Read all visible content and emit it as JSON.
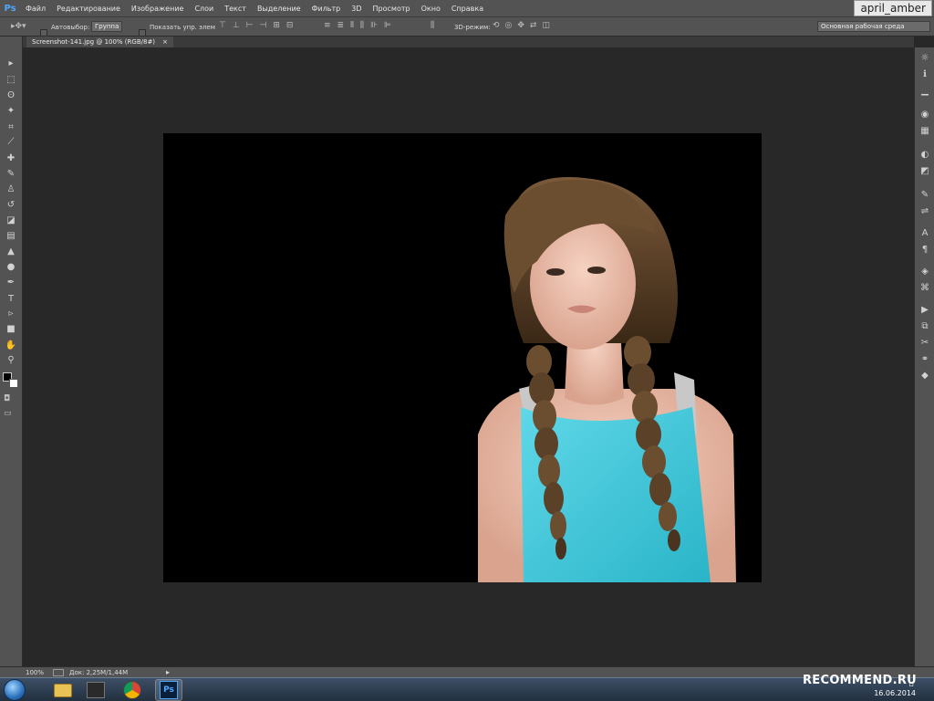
{
  "app": {
    "logo": "Ps"
  },
  "menu": [
    "Файл",
    "Редактирование",
    "Изображение",
    "Слои",
    "Текст",
    "Выделение",
    "Фильтр",
    "3D",
    "Просмотр",
    "Окно",
    "Справка"
  ],
  "watermark_user": "april_amber",
  "options": {
    "autoselect_label": "Автовыбор:",
    "autoselect_value": "Группа",
    "show_controls_label": "Показать упр. элем",
    "mode3d_label": "3D-режим:",
    "workspace": "Основная рабочая среда"
  },
  "document": {
    "tab_title": "Screenshot-141.jpg @ 100% (RGB/8#)",
    "close_glyph": "×"
  },
  "status": {
    "zoom": "100%",
    "doc_info": "Док: 2,25M/1,44M"
  },
  "taskbar": {
    "date": "16.06.2014",
    "watermark": "RECOMMEND.RU"
  },
  "tools": [
    {
      "name": "move-tool-icon",
      "glyph": "▸"
    },
    {
      "name": "marquee-tool-icon",
      "glyph": "⬚"
    },
    {
      "name": "lasso-tool-icon",
      "glyph": "ʘ"
    },
    {
      "name": "magic-wand-tool-icon",
      "glyph": "✦"
    },
    {
      "name": "crop-tool-icon",
      "glyph": "⌗"
    },
    {
      "name": "eyedropper-tool-icon",
      "glyph": "⟋"
    },
    {
      "name": "healing-brush-tool-icon",
      "glyph": "✚"
    },
    {
      "name": "brush-tool-icon",
      "glyph": "✎"
    },
    {
      "name": "clone-stamp-tool-icon",
      "glyph": "♙"
    },
    {
      "name": "history-brush-tool-icon",
      "glyph": "↺"
    },
    {
      "name": "eraser-tool-icon",
      "glyph": "◪"
    },
    {
      "name": "gradient-tool-icon",
      "glyph": "▤"
    },
    {
      "name": "blur-tool-icon",
      "glyph": "▲"
    },
    {
      "name": "dodge-tool-icon",
      "glyph": "●"
    },
    {
      "name": "pen-tool-icon",
      "glyph": "✒"
    },
    {
      "name": "type-tool-icon",
      "glyph": "T"
    },
    {
      "name": "path-selection-tool-icon",
      "glyph": "▹"
    },
    {
      "name": "shape-tool-icon",
      "glyph": "■"
    },
    {
      "name": "hand-tool-icon",
      "glyph": "✋"
    },
    {
      "name": "zoom-tool-icon",
      "glyph": "⚲"
    }
  ],
  "panels": [
    {
      "name": "adjustments-panel-icon",
      "glyph": "☼"
    },
    {
      "name": "info-panel-icon",
      "glyph": "ℹ"
    },
    {
      "name": "histogram-panel-icon",
      "glyph": "▁"
    },
    {
      "name": "navigator-panel-icon",
      "glyph": "◉"
    },
    {
      "name": "swatches-panel-icon",
      "glyph": "▦"
    },
    {
      "name": "color-panel-icon",
      "glyph": "◐"
    },
    {
      "name": "styles-panel-icon",
      "glyph": "◩"
    },
    {
      "name": "brush-panel-icon",
      "glyph": "✎"
    },
    {
      "name": "clone-source-panel-icon",
      "glyph": "⇌"
    },
    {
      "name": "character-panel-icon",
      "glyph": "A"
    },
    {
      "name": "paragraph-panel-icon",
      "glyph": "¶"
    },
    {
      "name": "3d-panel-icon",
      "glyph": "◈"
    },
    {
      "name": "paths-panel-icon",
      "glyph": "⌘"
    },
    {
      "name": "actions-panel-icon",
      "glyph": "▶"
    },
    {
      "name": "layer-comps-panel-icon",
      "glyph": "⧉"
    },
    {
      "name": "tool-presets-panel-icon",
      "glyph": "✂"
    },
    {
      "name": "channels-panel-icon",
      "glyph": "⚭"
    },
    {
      "name": "layers-panel-icon",
      "glyph": "◆"
    }
  ],
  "colors": {
    "ui_panel": "#535353",
    "canvas_bg": "#282828",
    "document_bg": "#000000",
    "tank_top": "#3fc6d8"
  }
}
